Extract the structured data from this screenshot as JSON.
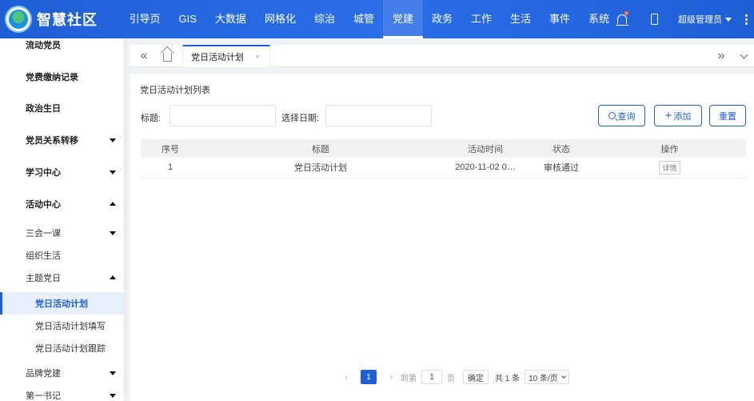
{
  "app": {
    "title": "智慧社区"
  },
  "nav": [
    {
      "label": "引导页"
    },
    {
      "label": "GIS"
    },
    {
      "label": "大数据"
    },
    {
      "label": "网格化"
    },
    {
      "label": "综治"
    },
    {
      "label": "城管"
    },
    {
      "label": "党建"
    },
    {
      "label": "政务"
    },
    {
      "label": "工作"
    },
    {
      "label": "生活"
    },
    {
      "label": "事件"
    },
    {
      "label": "系统"
    }
  ],
  "nav_active": "党建",
  "user": {
    "name": "超级管理员"
  },
  "sidebar": {
    "items": [
      {
        "label": "流动党员"
      },
      {
        "label": "党费缴纳记录"
      },
      {
        "label": "政治生日"
      },
      {
        "label": "党员关系转移"
      },
      {
        "label": "学习中心"
      },
      {
        "label": "活动中心"
      },
      {
        "label": "三会一课"
      },
      {
        "label": "组织生活"
      },
      {
        "label": "主题党日"
      },
      {
        "label": "党日活动计划"
      },
      {
        "label": "党日活动计划填写"
      },
      {
        "label": "党日活动计划跟踪"
      },
      {
        "label": "品牌党建"
      },
      {
        "label": "第一书记"
      }
    ]
  },
  "tabs": [
    {
      "label": "党日活动计划",
      "close": "×"
    }
  ],
  "tabbar": {
    "prev": "«",
    "next": "»"
  },
  "main": {
    "title": "党日活动计划列表",
    "filters": {
      "title_label": "标题:",
      "title_value": "",
      "date_label": "选择日期:",
      "date_value": ""
    },
    "buttons": {
      "search": "查询",
      "add": "添加",
      "reset": "重置"
    },
    "table": {
      "columns": [
        "序号",
        "标题",
        "活动时间",
        "状态",
        "操作"
      ],
      "rows": [
        {
          "index": "1",
          "title": "党日活动计划",
          "time": "2020-11-02 0…",
          "status": "审核通过",
          "action": "详情"
        }
      ]
    },
    "pagination": {
      "prev": "‹",
      "next": "›",
      "current": "1",
      "goto_label": "到第",
      "goto_value": "1",
      "page_unit": "页",
      "confirm": "确定",
      "total": "共 1 条",
      "page_size": "10 条/页"
    }
  }
}
